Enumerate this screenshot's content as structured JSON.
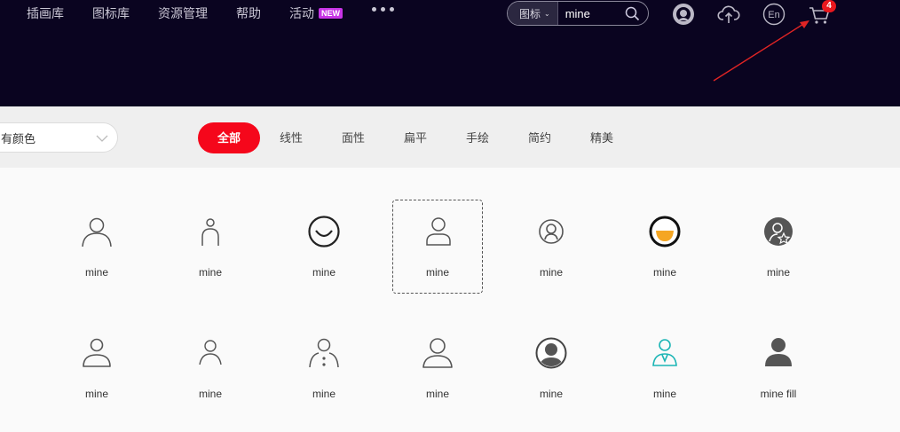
{
  "nav": {
    "items": [
      "插画库",
      "图标库",
      "资源管理",
      "帮助",
      "活动"
    ],
    "new_badge": "NEW"
  },
  "search": {
    "type_label": "图标",
    "query": "mine"
  },
  "header_icons": [
    "user-avatar-icon",
    "cloud-upload-icon",
    "language-en-icon",
    "cart-icon"
  ],
  "language_label": "En",
  "cart_count": "4",
  "filters": {
    "color_select": "有颜色",
    "tabs": [
      "全部",
      "线性",
      "面性",
      "扁平",
      "手绘",
      "简约",
      "精美"
    ],
    "active_tab": "全部"
  },
  "icons": {
    "row1": [
      "mine",
      "mine",
      "mine",
      "mine",
      "mine",
      "mine",
      "mine"
    ],
    "row2": [
      "mine",
      "mine",
      "mine",
      "mine",
      "mine",
      "mine",
      "mine fill"
    ]
  },
  "colors": {
    "header_bg": "#0a0420",
    "accent_red": "#f5071b",
    "badge_purple": "#c734e6",
    "teal_icon": "#1bb5b5",
    "orange_icon": "#f5a623"
  }
}
